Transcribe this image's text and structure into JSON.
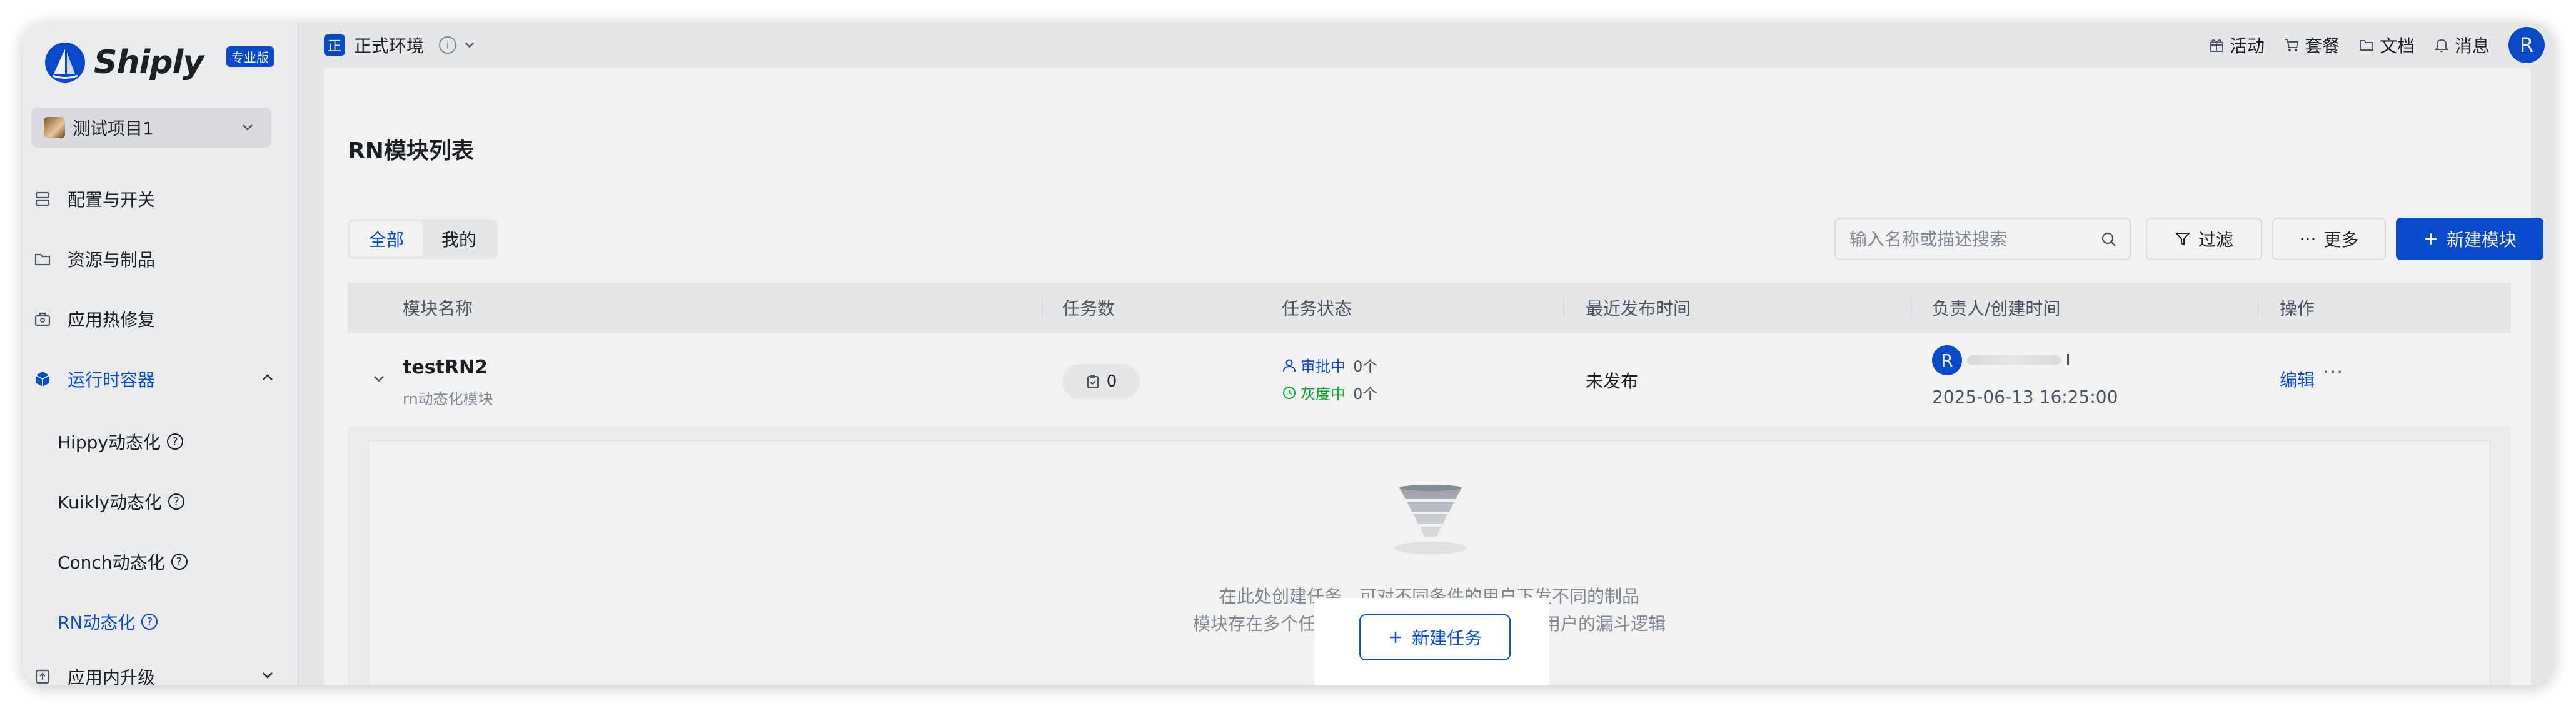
{
  "app": {
    "name": "Shiply",
    "edition_badge": "专业版"
  },
  "project": {
    "name": "测试项目1"
  },
  "sidebar": {
    "items": [
      {
        "label": "配置与开关"
      },
      {
        "label": "资源与制品"
      },
      {
        "label": "应用热修复"
      },
      {
        "label": "运行时容器",
        "expanded": true
      },
      {
        "label": "应用内升级"
      }
    ],
    "runtime_children": [
      {
        "label": "Hippy动态化"
      },
      {
        "label": "Kuikly动态化"
      },
      {
        "label": "Conch动态化"
      },
      {
        "label": "RN动态化",
        "active": true
      }
    ],
    "help_glyph": "?"
  },
  "topbar": {
    "env_badge": "正",
    "env_name": "正式环境",
    "info_glyph": "i",
    "links": {
      "activity": "活动",
      "plans": "套餐",
      "docs": "文档",
      "messages": "消息"
    },
    "user_initial": "R"
  },
  "page": {
    "title": "RN模块列表",
    "tabs": [
      {
        "label": "全部",
        "selected": true
      },
      {
        "label": "我的",
        "selected": false
      }
    ],
    "search_placeholder": "输入名称或描述搜索",
    "filter_label": "过滤",
    "more_label": "更多",
    "more_glyph": "···",
    "new_module_label": "新建模块"
  },
  "table": {
    "columns": {
      "name": "模块名称",
      "tasks": "任务数",
      "status": "任务状态",
      "last_publish": "最近发布时间",
      "owner": "负责人/创建时间",
      "actions": "操作"
    },
    "rows": [
      {
        "name": "testRN2",
        "description": "rn动态化模块",
        "task_count": "0",
        "status_approving_label": "审批中",
        "status_approving_count": "0个",
        "status_gray_label": "灰度中",
        "status_gray_count": "0个",
        "last_publish": "未发布",
        "owner_initial": "R",
        "created": "2025-06-13 16:25:00",
        "edit_label": "编辑",
        "more_glyph": "···"
      }
    ]
  },
  "empty_state": {
    "line1": "在此处创建任务，可对不同条件的用户下发不同的制品",
    "line2": "模块存在多个任务时，遵循从上到下过滤生效用户的漏斗逻辑",
    "new_task_label": "新建任务"
  },
  "colors": {
    "primary": "#0a4fd6",
    "approving": "#0a4fd6",
    "gray_release": "#00b42a",
    "text": "#1d2129",
    "muted": "#86909c"
  },
  "icons": {
    "config": "config-icon",
    "resource": "folder-icon",
    "hotfix": "hotfix-icon",
    "runtime": "cube-icon",
    "upgrade": "upgrade-icon",
    "activity": "gift-icon",
    "plans": "cart-icon",
    "docs": "folder-icon",
    "messages": "bell-icon",
    "search": "search-icon",
    "filter": "funnel-icon",
    "add": "plus-icon",
    "task": "clipboard-icon",
    "approving": "user-icon",
    "gray": "clock-icon",
    "empty": "funnel-illustration"
  }
}
